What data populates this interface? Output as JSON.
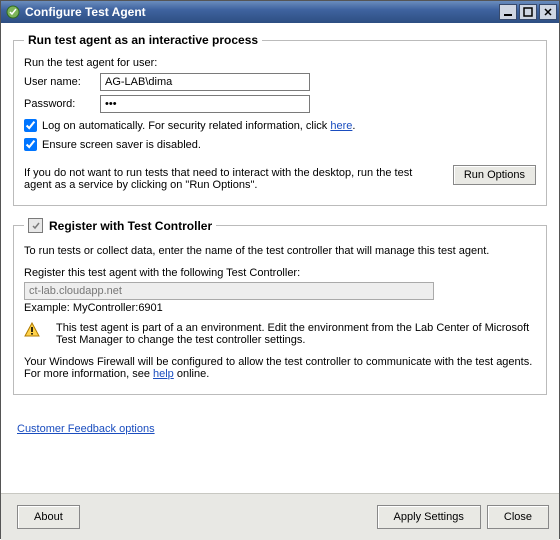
{
  "window": {
    "title": "Configure Test Agent"
  },
  "group1": {
    "legend": "Run test agent as an interactive process",
    "intro": "Run the test agent for user:",
    "username_label": "User name:",
    "username_value": "AG-LAB\\dima",
    "password_label": "Password:",
    "password_value": "•••",
    "chk_log_label_pre": "Log on automatically. For security related information, click ",
    "chk_log_link": "here",
    "chk_log_label_post": ".",
    "chk_saver_label": "Ensure screen saver is disabled.",
    "desc": "If you do not want to run tests that need to interact with the desktop, run the test agent as a service by clicking on \"Run Options\".",
    "run_options_btn": "Run Options"
  },
  "group2": {
    "legend": "Register with Test Controller",
    "intro": "To run tests or collect data, enter the name of the test controller that will manage this test agent.",
    "reg_label": "Register this test agent with the following Test Controller:",
    "controller_value": "ct-lab.cloudapp.net",
    "example": "Example: MyController:6901",
    "warn": "This test agent is part of a an environment. Edit the environment from the Lab Center of Microsoft Test Manager to change the test controller settings.",
    "firewall_pre": "Your Windows Firewall will be configured to allow the test controller to communicate with the test agents. For more information, see ",
    "firewall_link": "help",
    "firewall_post": " online."
  },
  "links": {
    "feedback": "Customer Feedback options"
  },
  "footer": {
    "about": "About",
    "apply": "Apply Settings",
    "close": "Close"
  }
}
